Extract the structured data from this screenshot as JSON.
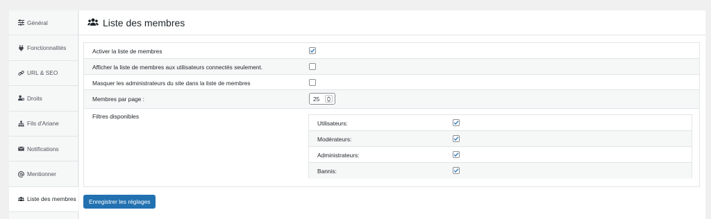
{
  "sidebar": {
    "items": [
      {
        "label": "Général",
        "icon": "sliders-icon"
      },
      {
        "label": "Fonctionnalités",
        "icon": "plug-icon"
      },
      {
        "label": "URL & SEO",
        "icon": "link-icon"
      },
      {
        "label": "Droits",
        "icon": "users-key-icon"
      },
      {
        "label": "Fils d'Ariane",
        "icon": "sitemap-icon"
      },
      {
        "label": "Notifications",
        "icon": "envelope-icon"
      },
      {
        "label": "Mentionner",
        "icon": "at-icon"
      },
      {
        "label": "Liste des membres",
        "icon": "users-icon",
        "active": true
      }
    ]
  },
  "page": {
    "title": "Liste des membres",
    "title_icon": "users-icon"
  },
  "settings": {
    "enable_list": {
      "label": "Activer la liste de membres",
      "checked": true
    },
    "logged_only": {
      "label": "Afficher la liste de membres aux utilisateurs connectés seulement.",
      "checked": false
    },
    "hide_admins": {
      "label": "Masquer les administrateurs du site dans la liste de membres",
      "checked": false
    },
    "per_page": {
      "label": "Membres par page :",
      "value": "25"
    },
    "filters": {
      "label": "Filtres disponibles",
      "items": [
        {
          "label": "Utilisateurs:",
          "checked": true
        },
        {
          "label": "Modérateurs:",
          "checked": true
        },
        {
          "label": "Administrateurs:",
          "checked": true
        },
        {
          "label": "Bannis:",
          "checked": true
        }
      ]
    }
  },
  "save_button": {
    "label": "Enregistrer les réglages"
  },
  "colors": {
    "accent": "#2271b1",
    "background": "#f0f0f1",
    "panel": "#ffffff"
  }
}
